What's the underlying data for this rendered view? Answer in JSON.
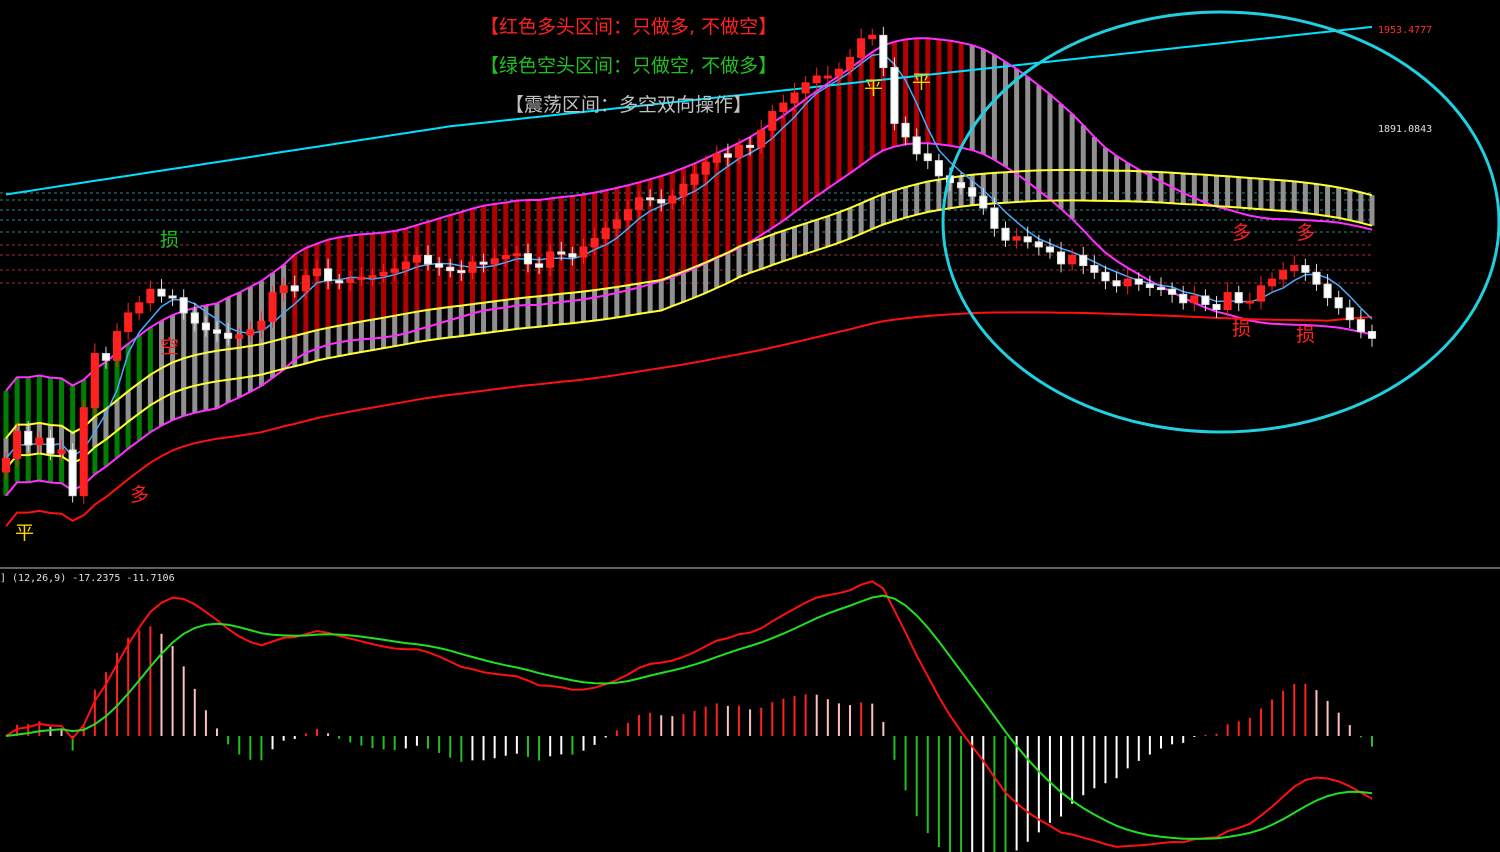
{
  "chart_data": [
    {
      "type": "candlestick",
      "panel": "main",
      "annotations": [
        {
          "text": "【红色多头区间：只做多, 不做空】",
          "color": "#ff2020"
        },
        {
          "text": "【绿色空头区间：只做空, 不做多】",
          "color": "#20c020"
        },
        {
          "text": "【震荡区间：多空双向操作】",
          "color": "#c0c0c0"
        }
      ],
      "price_labels": [
        "1953.4777",
        "1891.0843"
      ],
      "signal_marks": [
        {
          "text": "平",
          "color": "#ffd000"
        },
        {
          "text": "多",
          "color": "#ff2020"
        },
        {
          "text": "空",
          "color": "#ff2020"
        },
        {
          "text": "损",
          "color": "#20c020"
        },
        {
          "text": "平",
          "color": "#ffd000"
        },
        {
          "text": "平",
          "color": "#ffd000"
        },
        {
          "text": "多",
          "color": "#ff2020"
        },
        {
          "text": "多",
          "color": "#ff2020"
        },
        {
          "text": "损",
          "color": "#ff2020"
        },
        {
          "text": "损",
          "color": "#ff2020"
        }
      ],
      "close_prices": [
        1700,
        1716,
        1708,
        1712,
        1703,
        1705,
        1678,
        1730,
        1762,
        1758,
        1775,
        1786,
        1792,
        1800,
        1796,
        1795,
        1786,
        1780,
        1776,
        1774,
        1771,
        1773,
        1776,
        1781,
        1798,
        1802,
        1799,
        1808,
        1812,
        1805,
        1804,
        1806,
        1807,
        1808,
        1810,
        1812,
        1816,
        1820,
        1815,
        1813,
        1811,
        1810,
        1816,
        1815,
        1818,
        1820,
        1821,
        1815,
        1813,
        1822,
        1821,
        1819,
        1825,
        1830,
        1836,
        1841,
        1847,
        1854,
        1853,
        1851,
        1855,
        1862,
        1868,
        1875,
        1880,
        1878,
        1885,
        1884,
        1894,
        1905,
        1910,
        1916,
        1922,
        1926,
        1926,
        1930,
        1937,
        1948,
        1950,
        1931,
        1898,
        1890,
        1880,
        1876,
        1867,
        1863,
        1860,
        1855,
        1848,
        1836,
        1829,
        1831,
        1828,
        1825,
        1822,
        1815,
        1820,
        1814,
        1810,
        1805,
        1802,
        1806,
        1803,
        1801,
        1800,
        1797,
        1792,
        1796,
        1791,
        1788,
        1798,
        1792,
        1793,
        1802,
        1806,
        1811,
        1814,
        1810,
        1803,
        1795,
        1789,
        1782,
        1775,
        1771
      ],
      "bullish_regions": [
        "red bars region"
      ],
      "series": [
        {
          "name": "",
          "color": "#00e0ff"
        },
        {
          "name": "",
          "color": "#ff30ff"
        },
        {
          "name": "",
          "color": "#ffff30"
        },
        {
          "name": "",
          "color": "#ff1010"
        },
        {
          "name": "",
          "color": "#4aa8ff"
        }
      ]
    },
    {
      "type": "macd",
      "panel": "indicator",
      "label": "] (12,26,9) -17.2375 -11.7106",
      "series": [
        {
          "name": "",
          "color": "#ff1010"
        },
        {
          "name": "",
          "color": "#20e020"
        }
      ]
    }
  ],
  "colors": {
    "background": "#000000",
    "bull_fill": "#ff2020",
    "bear_fill": "#ffffff",
    "band_red": "#b00000",
    "band_green": "#008000",
    "band_gray": "#909090",
    "circle": "#20d0e0"
  }
}
